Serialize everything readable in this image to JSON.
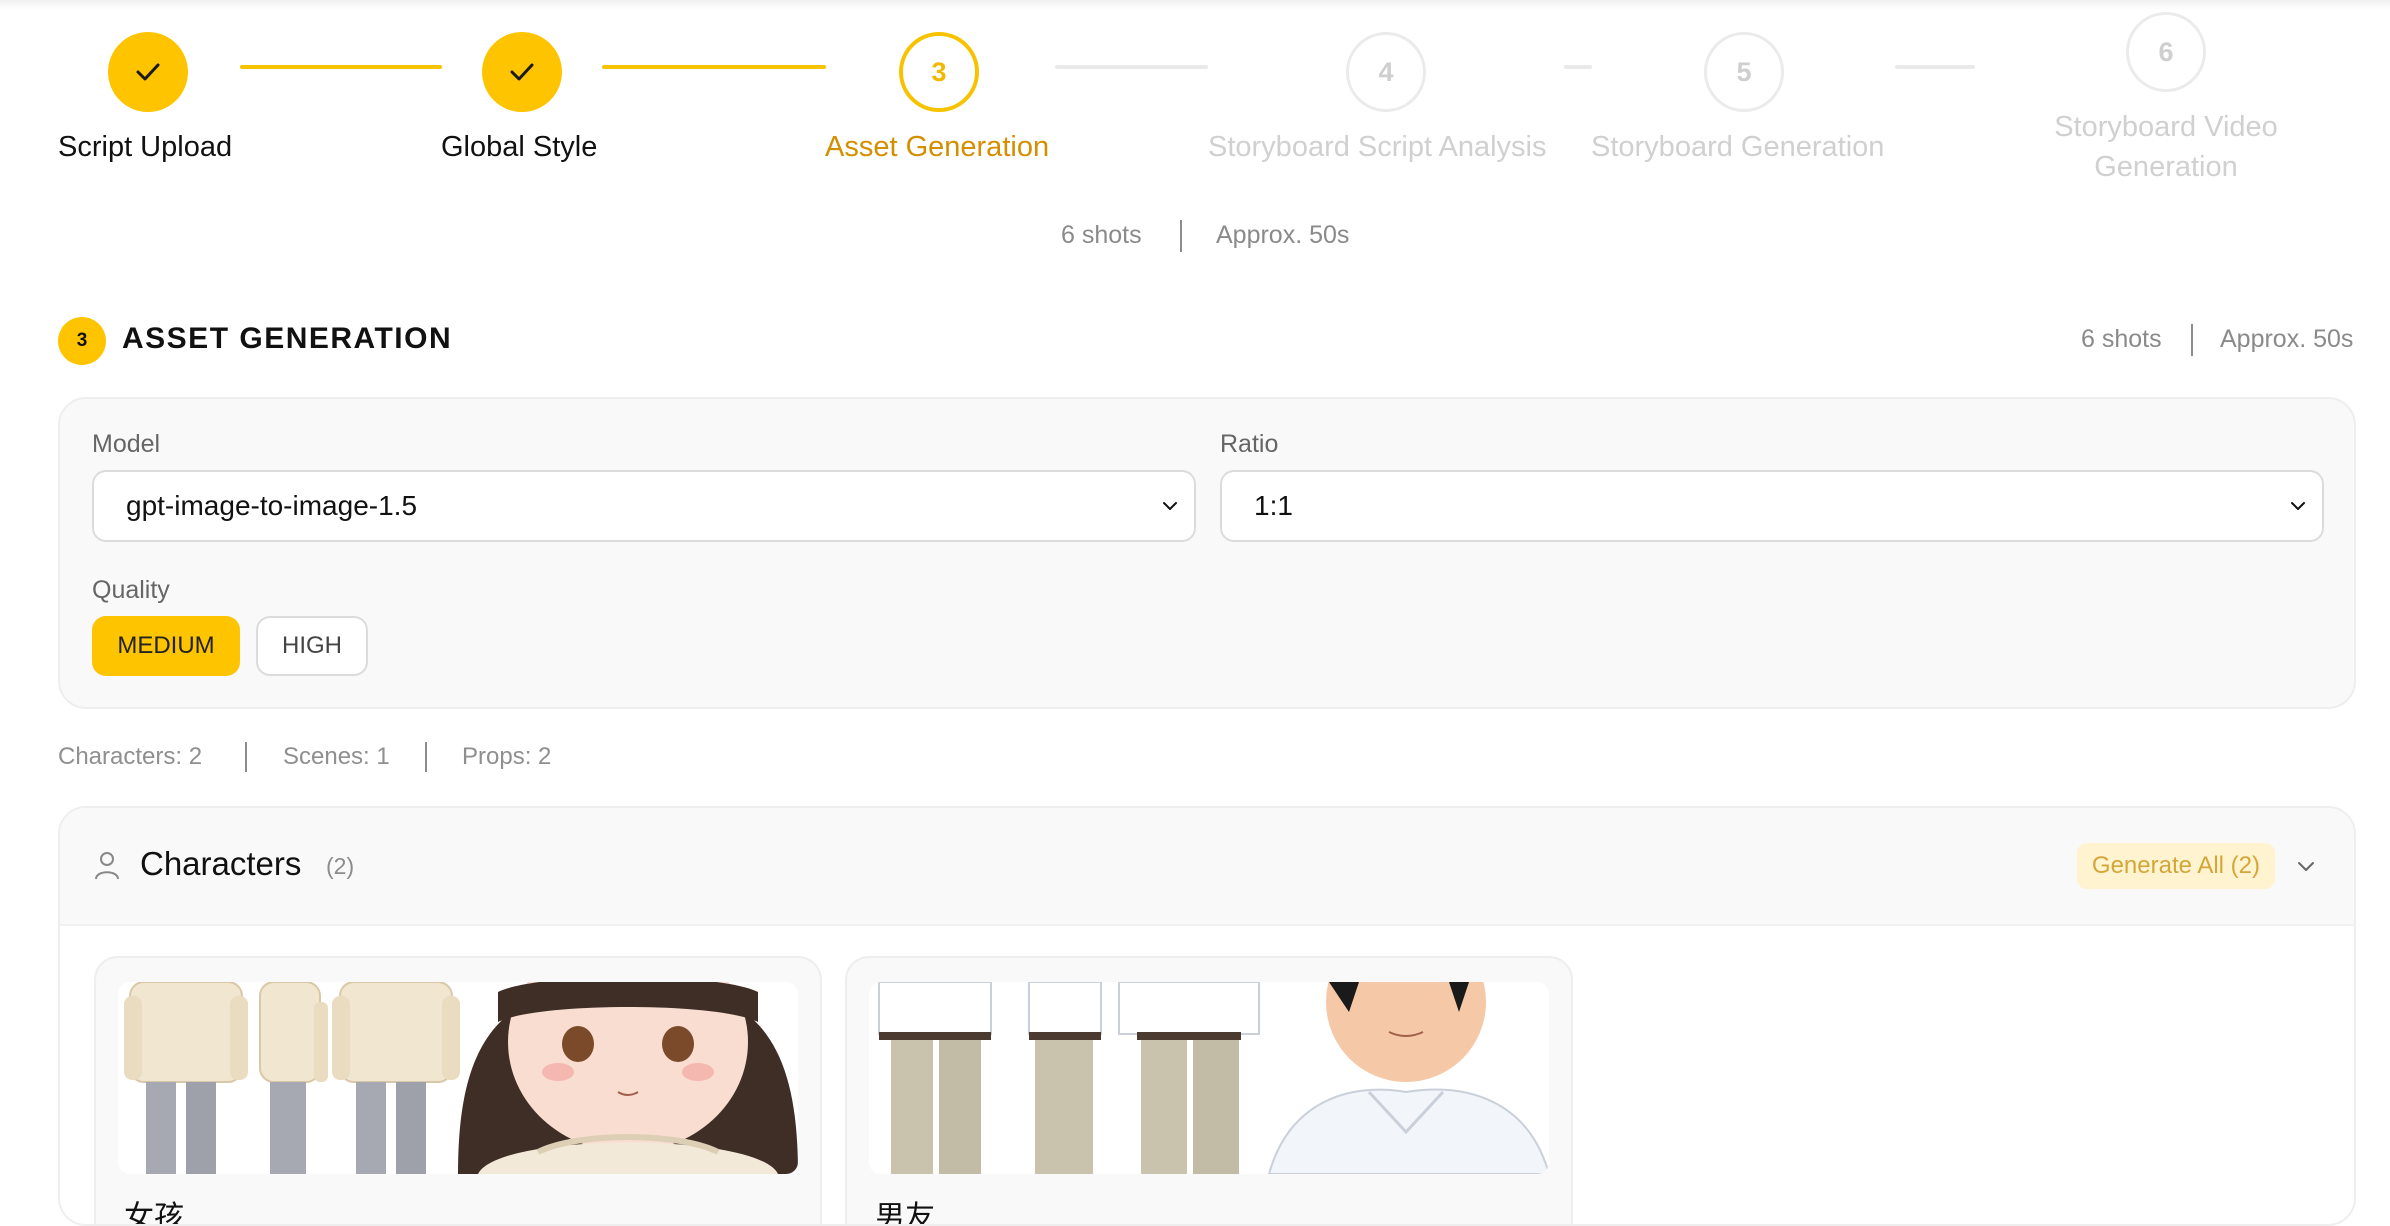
{
  "stepper": {
    "steps": [
      {
        "number": "1",
        "label": "Script Upload",
        "state": "done"
      },
      {
        "number": "2",
        "label": "Global Style",
        "state": "done"
      },
      {
        "number": "3",
        "label": "Asset Generation",
        "state": "current"
      },
      {
        "number": "4",
        "label": "Storyboard Script Analysis",
        "state": "future"
      },
      {
        "number": "5",
        "label": "Storyboard Generation",
        "state": "future"
      },
      {
        "number": "6",
        "label_line1": "Storyboard Video",
        "label_line2": "Generation",
        "state": "future"
      }
    ],
    "shots": "6 shots",
    "duration": "Approx. 50s"
  },
  "section": {
    "number": "3",
    "title": "ASSET GENERATION",
    "shots": "6 shots",
    "duration": "Approx. 50s"
  },
  "settings": {
    "model_label": "Model",
    "model_value": "gpt-image-to-image-1.5",
    "ratio_label": "Ratio",
    "ratio_value": "1:1",
    "quality_label": "Quality",
    "quality_options": [
      {
        "label": "MEDIUM",
        "selected": true
      },
      {
        "label": "HIGH",
        "selected": false
      }
    ]
  },
  "stats": {
    "characters": "Characters: 2",
    "scenes": "Scenes: 1",
    "props": "Props: 2"
  },
  "characters": {
    "title": "Characters",
    "count": "(2)",
    "generate_all": "Generate All (2)",
    "items": [
      {
        "name": "女孩"
      },
      {
        "name": "男友"
      }
    ]
  },
  "colors": {
    "accent": "#ffc400",
    "accent_text": "#d48f00",
    "muted": "#d0d0d0"
  }
}
